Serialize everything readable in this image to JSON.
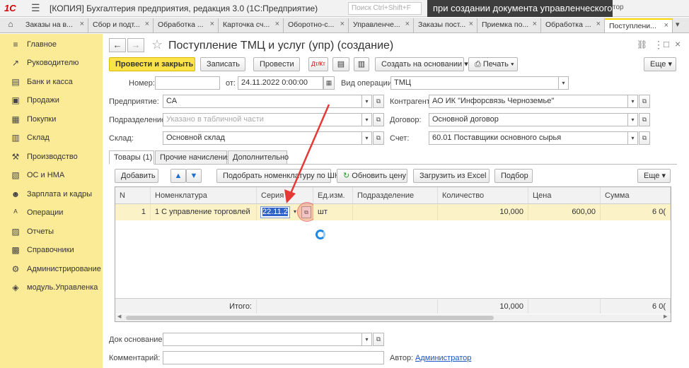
{
  "titlebar": {
    "logo": "1С",
    "title": "[КОПИЯ] Бухгалтерия предприятия, редакция 3.0  (1С:Предприятие)",
    "search_placeholder": "Поиск Ctrl+Shift+F",
    "overlay_text": "при создании документа управленческого",
    "user_text": "тор"
  },
  "tabs": [
    {
      "label": "Заказы на в..."
    },
    {
      "label": "Сбор и подт..."
    },
    {
      "label": "Обработка ..."
    },
    {
      "label": "Карточка сч..."
    },
    {
      "label": "Оборотно-с..."
    },
    {
      "label": "Управленче..."
    },
    {
      "label": "Заказы пост..."
    },
    {
      "label": "Приемка по..."
    },
    {
      "label": "Обработка ..."
    },
    {
      "label": "Поступлени..."
    }
  ],
  "sidebar": {
    "items": [
      {
        "label": "Главное",
        "icon": "≡"
      },
      {
        "label": "Руководителю",
        "icon": "↗"
      },
      {
        "label": "Банк и касса",
        "icon": "▤"
      },
      {
        "label": "Продажи",
        "icon": "▣"
      },
      {
        "label": "Покупки",
        "icon": "▦"
      },
      {
        "label": "Склад",
        "icon": "▥"
      },
      {
        "label": "Производство",
        "icon": "⚒"
      },
      {
        "label": "ОС и НМА",
        "icon": "▧"
      },
      {
        "label": "Зарплата и кадры",
        "icon": "☻"
      },
      {
        "label": "Операции",
        "icon": "ᴬ"
      },
      {
        "label": "Отчеты",
        "icon": "▨"
      },
      {
        "label": "Справочники",
        "icon": "▩"
      },
      {
        "label": "Администрирование",
        "icon": "⚙"
      },
      {
        "label": "модуль.Управленка",
        "icon": "◈"
      }
    ]
  },
  "form": {
    "title": "Поступление ТМЦ и услуг (упр) (создание)",
    "toolbar": {
      "post_close": "Провести и закрыть",
      "save": "Записать",
      "post": "Провести",
      "create_based": "Создать на основании",
      "print": "Печать",
      "more": "Еще"
    },
    "number_label": "Номер:",
    "number_value": "",
    "from_label": "от:",
    "date_value": "24.11.2022  0:00:00",
    "optype_label": "Вид операции:",
    "optype_value": "ТМЦ",
    "company_label": "Предприятие:",
    "company_value": "СА",
    "counterparty_label": "Контрагент:",
    "counterparty_value": "АО ИК \"Инфорсвязь Черноземье\"",
    "division_label": "Подразделение:",
    "division_placeholder": "Указано в табличной части",
    "contract_label": "Договор:",
    "contract_value": "Основной договор",
    "warehouse_label": "Склад:",
    "warehouse_value": "Основной склад",
    "account_label": "Счет:",
    "account_value": "60.01 Поставщики основного сырья",
    "subtabs": [
      "Товары (1)",
      "Прочие начисления",
      "Дополнительно"
    ],
    "table_toolbar": {
      "add": "Добавить",
      "pick_barcode": "Подобрать номенклатуру по ШК",
      "refresh_price": "Обновить цену",
      "load_excel": "Загрузить из Excel",
      "selection": "Подбор",
      "more": "Еще"
    },
    "table": {
      "headers": [
        "N",
        "Номенклатура",
        "Серия",
        "Ед.изм.",
        "Подразделение",
        "Количество",
        "Цена",
        "Сумма"
      ],
      "rows": [
        {
          "n": "1",
          "item": "1 С управление торговлей",
          "series": "22.11.2",
          "unit": "шт",
          "division": "",
          "qty": "10,000",
          "price": "600,00",
          "sum": "6 0("
        }
      ],
      "footer_label": "Итого:",
      "footer_qty": "10,000",
      "footer_sum": "6 0("
    },
    "base_doc_label": "Док основание:",
    "base_doc_value": "",
    "comment_label": "Комментарий:",
    "comment_value": "",
    "author_label": "Автор:",
    "author_value": "Администратор"
  },
  "colors": {
    "sidebar_bg": "#fbeb96",
    "primary_button": "#fce34a",
    "selected_row": "#fbf2c8",
    "annotation_arrow": "#e53935",
    "link": "#1a55c8"
  }
}
